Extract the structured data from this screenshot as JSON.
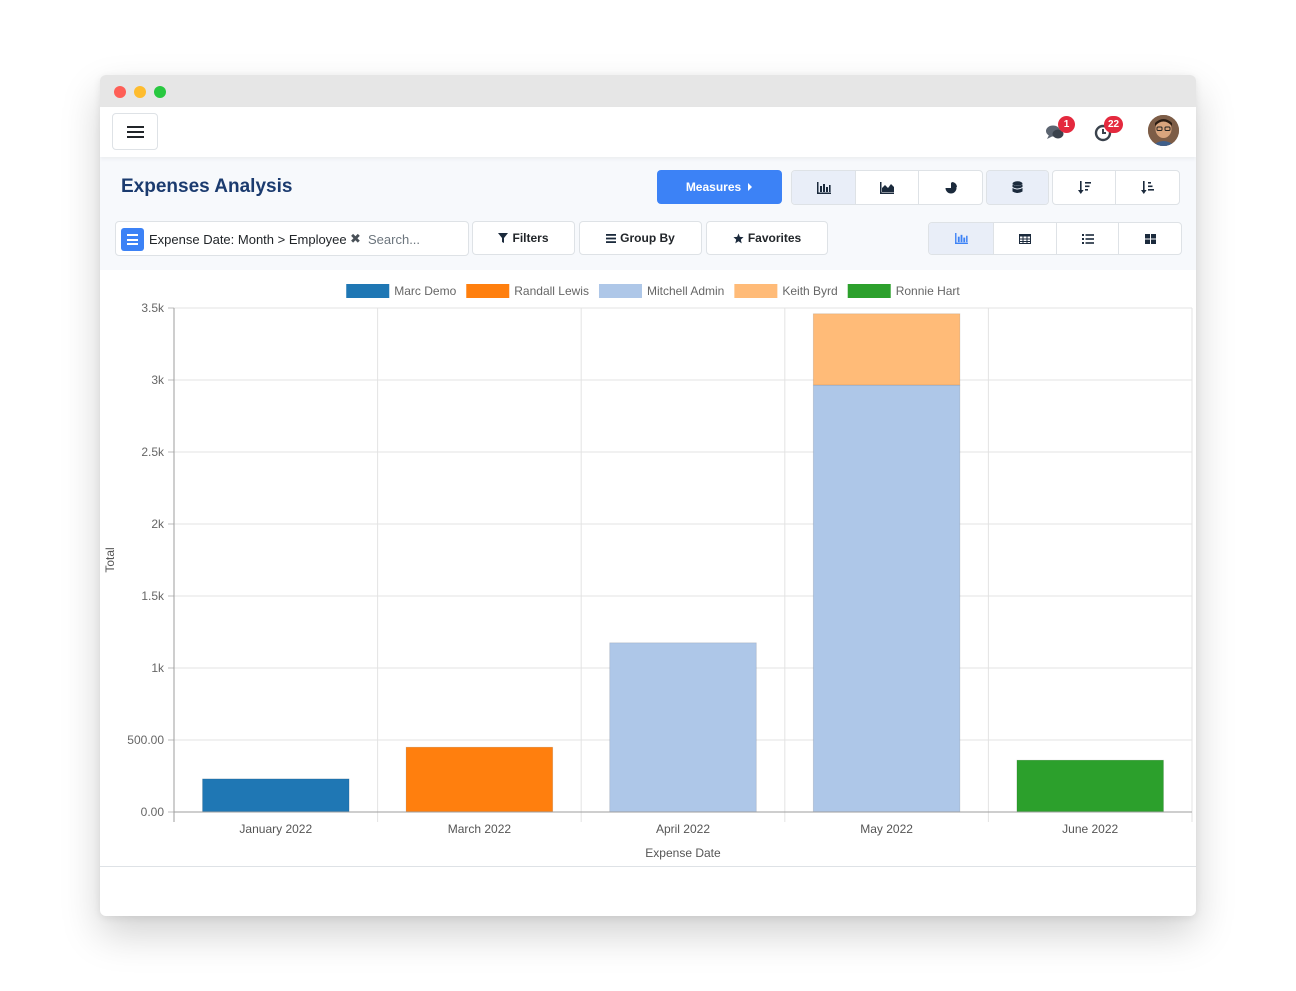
{
  "navbar": {
    "messages_badge": "1",
    "activities_badge": "22"
  },
  "control_panel": {
    "title": "Expenses Analysis",
    "measures_label": "Measures",
    "search": {
      "facet": "Expense Date: Month > Employee",
      "placeholder": "Search..."
    },
    "filters_label": "Filters",
    "group_by_label": "Group By",
    "favorites_label": "Favorites"
  },
  "chart_data": {
    "type": "bar",
    "stacked": true,
    "categories": [
      "January 2022",
      "March 2022",
      "April 2022",
      "May 2022",
      "June 2022"
    ],
    "series": [
      {
        "name": "Marc Demo",
        "color": "#1f77b4",
        "values": [
          230,
          0,
          0,
          0,
          0
        ]
      },
      {
        "name": "Randall Lewis",
        "color": "#ff7f0e",
        "values": [
          0,
          450,
          0,
          0,
          0
        ]
      },
      {
        "name": "Mitchell Admin",
        "color": "#aec7e8",
        "values": [
          0,
          0,
          1175,
          2965,
          0
        ]
      },
      {
        "name": "Keith Byrd",
        "color": "#ffbb78",
        "values": [
          0,
          0,
          0,
          495,
          0
        ]
      },
      {
        "name": "Ronnie Hart",
        "color": "#2ca02c",
        "values": [
          0,
          0,
          0,
          0,
          360
        ]
      }
    ],
    "xlabel": "Expense Date",
    "ylabel": "Total",
    "ylim": [
      0,
      3500
    ],
    "yticks": [
      {
        "value": 0,
        "label": "0.00"
      },
      {
        "value": 500,
        "label": "500.00"
      },
      {
        "value": 1000,
        "label": "1k"
      },
      {
        "value": 1500,
        "label": "1.5k"
      },
      {
        "value": 2000,
        "label": "2k"
      },
      {
        "value": 2500,
        "label": "2.5k"
      },
      {
        "value": 3000,
        "label": "3k"
      },
      {
        "value": 3500,
        "label": "3.5k"
      }
    ],
    "grid": true,
    "legend": "top"
  }
}
